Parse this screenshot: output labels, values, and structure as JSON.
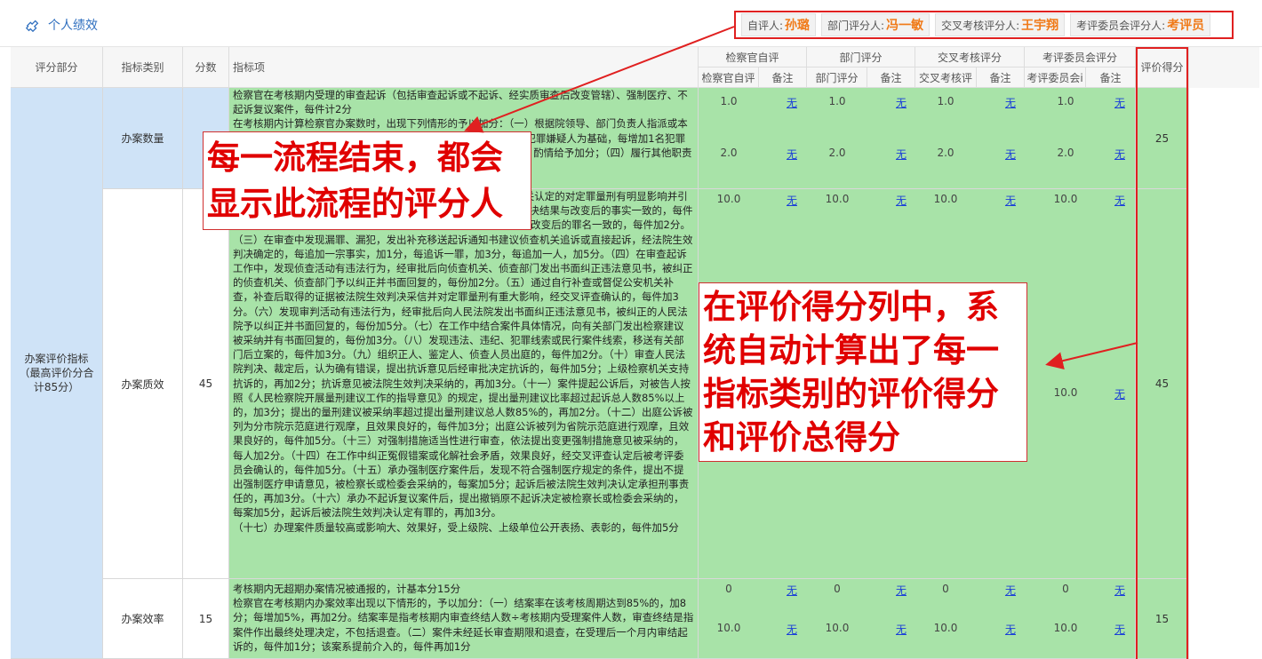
{
  "header": {
    "title": "个人绩效",
    "evaluators": [
      {
        "label": "自评人:",
        "name": "孙璐"
      },
      {
        "label": "部门评分人:",
        "name": "冯一敏"
      },
      {
        "label": "交叉考核评分人:",
        "name": "王宇翔"
      },
      {
        "label": "考评委员会评分人:",
        "name": "考评员"
      }
    ]
  },
  "table": {
    "columns": {
      "dept": "评分部分",
      "category": "指标类别",
      "score": "分数",
      "item": "指标项",
      "self_group": "检察官自评",
      "self_score": "检察官自评",
      "self_note": "备注",
      "dept_group": "部门评分",
      "dept_score": "部门评分",
      "dept_note": "备注",
      "cross_group": "交叉考核评分",
      "cross_score": "交叉考核评",
      "cross_note": "备注",
      "comm_group": "考评委员会评分",
      "comm_score": "考评委员会i",
      "comm_note": "备注",
      "result": "评价得分"
    },
    "section_label": "办案评价指标（最高评价分合计85分）",
    "rows": [
      {
        "category": "办案数量",
        "score": "2",
        "item_text": "检察官在考核期内受理的审查起诉（包括审查起诉或不起诉、经实质审查后改变管辖）、强制医疗、不起诉复议案件，每件计2分\n在考核期内计算检察官办案数时，出现下列情形的予以加分：（一）根据院领导、部门负责人指派或本人提出，办理重大疑难复杂案件，共同犯罪起诉案件，每案以3名犯罪嫌疑人为基础，每增加1名犯罪嫌疑人加1分，最多不超过10分；（三）参与绩效考核交叉评查的，酌情给予加分；（四）履行其他职责的，按《检察官检察机关司法办案核阅办法》第",
        "marks": [
          {
            "self": "1.0",
            "dept": "1.0",
            "cross": "1.0",
            "comm": "1.0"
          },
          {
            "self": "2.0",
            "dept": "2.0",
            "cross": "2.0",
            "comm": "2.0"
          }
        ],
        "note": "无",
        "result": "25"
      },
      {
        "category": "办案质效",
        "score": "45",
        "item_text": "检察官办理的案件，出现下列情形的予以加分：（一）改变侦查机关认定的对定罪量刑有明显影响并引起法定刑量大变化的犯罪嫌疑人基本情况、犯罪事实，法院生效判决结果与改变后的事实一致的，每件加2分。（二）改变侦查机关移送起诉的罪名，法院生效判决结果与改变后的罪名一致的，每件加2分。（三）在审查中发现漏罪、漏犯，发出补充移送起诉通知书建议侦查机关追诉或直接起诉，经法院生效判决确定的，每追加一宗事实，加1分，每追诉一罪，加3分，每追加一人，加5分。（四）在审查起诉工作中，发现侦查活动有违法行为，经审批后向侦查机关、侦查部门发出书面纠正违法意见书，被纠正的侦查机关、侦查部门予以纠正并书面回复的，每份加2分。（五）通过自行补查或督促公安机关补查，补查后取得的证据被法院生效判决采信并对定罪量刑有重大影响，经交叉评查确认的，每件加3分。（六）发现审判活动有违法行为，经审批后向人民法院发出书面纠正违法意见书，被纠正的人民法院予以纠正并书面回复的，每份加5分。（七）在工作中结合案件具体情况，向有关部门发出检察建议被采纳并有书面回复的，每份加3分。（八）发现违法、违纪、犯罪线索或民行案件线索，移送有关部门后立案的，每件加3分。（九）组织正人、鉴定人、侦查人员出庭的，每件加2分。（十）审查人民法院判决、裁定后，认为确有错误，提出抗诉意见后经审批决定抗诉的，每件加5分；上级检察机关支持抗诉的，再加2分；抗诉意见被法院生效判决采纳的，再加3分。（十一）案件提起公诉后，对被告人按照《人民检察院开展量刑建议工作的指导意见》的规定，提出量刑建议比率超过起诉总人数85%以上的，加3分；提出的量刑建议被采纳率超过提出量刑建议总人数85%的，再加2分。（十二）出庭公诉被列为分市院示范庭进行观摩，且效果良好的，每件加3分；出庭公诉被列为省院示范庭进行观摩，且效果良好的，每件加5分。（十三）对强制措施适当性进行审查，依法提出变更强制措施意见被采纳的，每人加2分。（十四）在工作中纠正冤假错案或化解社会矛盾，效果良好，经交叉评查认定后被考评委员会确认的，每件加5分。（十五）承办强制医疗案件后，发现不符合强制医疗规定的条件，提出不提出强制医疗申请意见，被检察长或检委会采纳的，每案加5分；起诉后被法院生效判决认定承担刑事责任的，再加3分。（十六）承办不起诉复议案件后，提出撤销原不起诉决定被检察长或检委会采纳的，每案加5分，起诉后被法院生效判决认定有罪的，再加3分。\n（十七）办理案件质量较高或影响大、效果好，受上级院、上级单位公开表扬、表彰的，每件加5分",
        "marks": [
          {
            "self": "10.0",
            "dept": "10.0",
            "cross": "10.0",
            "comm": "10.0"
          },
          {
            "self": "10.0",
            "dept": "10.0",
            "cross": "10.0",
            "comm": "10.0"
          }
        ],
        "note": "无",
        "result": "45"
      },
      {
        "category": "办案效率",
        "score": "15",
        "item_text": "考核期内无超期办案情况被通报的，计基本分15分\n检察官在考核期内办案效率出现以下情形的，予以加分：（一）结案率在该考核周期达到85%的，加8分；每增加5%，再加2分。结案率是指考核期内审查终结人数÷考核期内受理案件人数，审查终结是指案件作出最终处理决定，不包括退查。（二）案件未经延长审查期限和退查，在受理后一个月内审结起诉的，每件加1分；该案系提前介入的，每件再加1分",
        "marks": [
          {
            "self": "0",
            "dept": "0",
            "cross": "0",
            "comm": "0"
          },
          {
            "self": "10.0",
            "dept": "10.0",
            "cross": "10.0",
            "comm": "10.0"
          }
        ],
        "note": "无",
        "result": "15"
      }
    ]
  },
  "annotations": {
    "callout1": "每一流程结束，都会显示此流程的评分人",
    "callout2": "在评价得分列中，系统自动计算出了每一指标类别的评价得分和评价总得分"
  },
  "colors": {
    "accent_red": "#e02020",
    "name_orange": "#f07a18",
    "row_green": "#a8e3a8",
    "row_blue": "#cfe3f7",
    "link_blue": "#1a3fd8"
  }
}
